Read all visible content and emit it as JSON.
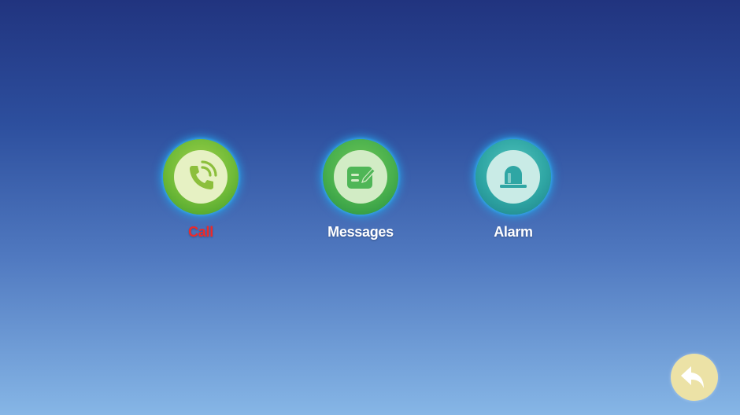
{
  "menu": {
    "items": [
      {
        "label": "Call",
        "icon": "phone-icon",
        "active": true
      },
      {
        "label": "Messages",
        "icon": "message-edit-icon",
        "active": false
      },
      {
        "label": "Alarm",
        "icon": "alarm-siren-icon",
        "active": false
      }
    ]
  },
  "back": {
    "icon": "back-arrow-icon"
  },
  "colors": {
    "active_label": "#ee2a2a",
    "label": "#ffffff",
    "back_button": "#ece2a6"
  }
}
